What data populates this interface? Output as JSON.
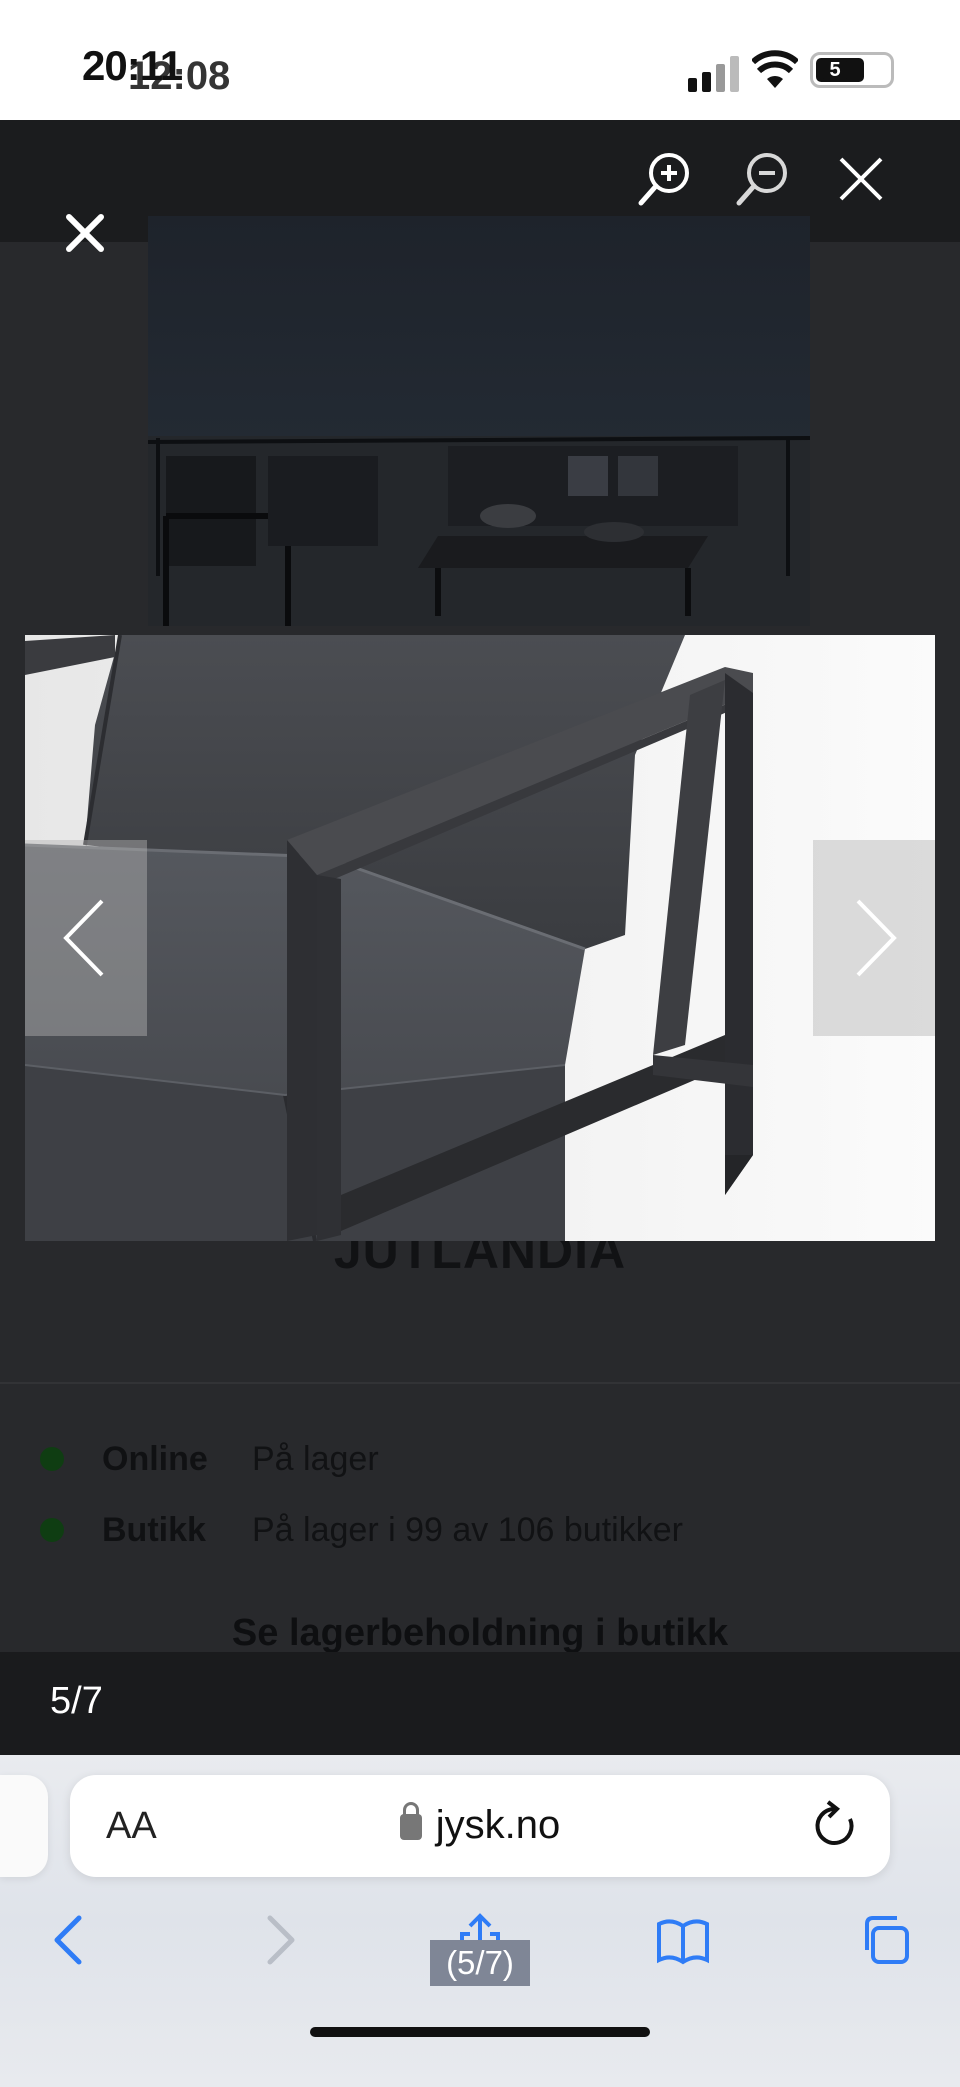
{
  "status_bar": {
    "time": "20:11",
    "time_overlay": "12:08",
    "battery": "5"
  },
  "product": {
    "title": "JUTLANDIA",
    "stock": [
      {
        "label": "Online",
        "value": "På lager"
      },
      {
        "label": "Butikk",
        "value": "På lager i 99 av 106 butikker"
      }
    ],
    "store_link": "Se lagerbeholdning i butikk"
  },
  "lightbox": {
    "counter": "5/7"
  },
  "browser": {
    "text_size_label": "AA",
    "domain": "jysk.no",
    "caption": "(5/7)"
  },
  "icons": {
    "zoom_in": "zoom-in-icon",
    "zoom_out": "zoom-out-icon",
    "close": "close-icon",
    "prev": "chevron-left-icon",
    "next": "chevron-right-icon"
  },
  "colors": {
    "stock_dot": "#0f3d12",
    "link_blue": "#2f7cf6"
  }
}
